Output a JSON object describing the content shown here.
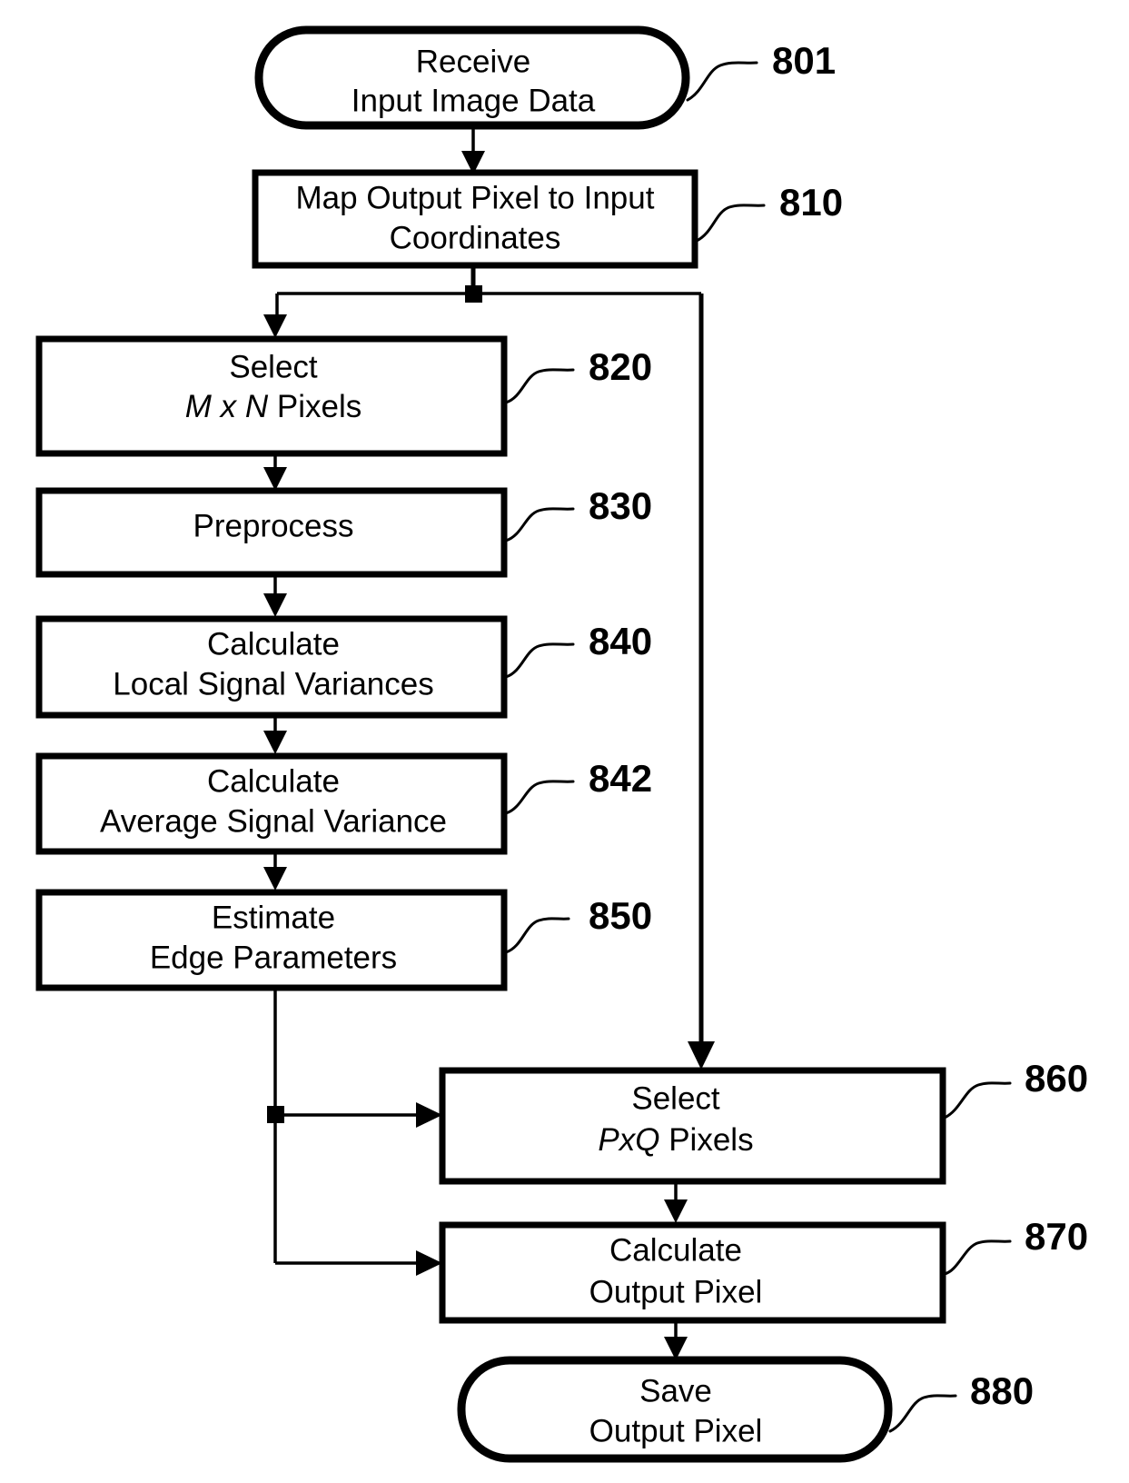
{
  "figure": {
    "type": "flowchart",
    "title": "",
    "background_color": "#ffffff",
    "line_color": "#000000",
    "text_color": "#000000"
  },
  "nodes": [
    {
      "id": "801",
      "shape": "terminator",
      "ref": "801",
      "line1": "Receive",
      "line2": "Input Image  Data"
    },
    {
      "id": "810",
      "shape": "process",
      "ref": "810",
      "line1": "Map Output Pixel to Input",
      "line2": "Coordinates"
    },
    {
      "id": "820",
      "shape": "process",
      "ref": "820",
      "line1": "Select",
      "line2_italic": "M x N",
      "line2_rest": " Pixels"
    },
    {
      "id": "830",
      "shape": "process",
      "ref": "830",
      "line1": "Preprocess",
      "line2": ""
    },
    {
      "id": "840",
      "shape": "process",
      "ref": "840",
      "line1": "Calculate",
      "line2": "Local Signal Variances"
    },
    {
      "id": "842",
      "shape": "process",
      "ref": "842",
      "line1": "Calculate",
      "line2": "Average Signal Variance"
    },
    {
      "id": "850",
      "shape": "process",
      "ref": "850",
      "line1": "Estimate",
      "line2": "Edge Parameters"
    },
    {
      "id": "860",
      "shape": "process",
      "ref": "860",
      "line1": "Select",
      "line2_italic": "PxQ",
      "line2_rest": " Pixels"
    },
    {
      "id": "870",
      "shape": "process",
      "ref": "870",
      "line1": "Calculate",
      "line2": "Output Pixel"
    },
    {
      "id": "880",
      "shape": "terminator",
      "ref": "880",
      "line1": "Save",
      "line2": "Output Pixel"
    }
  ],
  "edges": [
    {
      "from": "801",
      "to": "810",
      "style": "arrow-down"
    },
    {
      "from": "810",
      "to": "820",
      "style": "branch-left-down"
    },
    {
      "from": "810",
      "to": "860",
      "style": "branch-right-down"
    },
    {
      "from": "820",
      "to": "830",
      "style": "arrow-down"
    },
    {
      "from": "830",
      "to": "840",
      "style": "arrow-down"
    },
    {
      "from": "840",
      "to": "842",
      "style": "arrow-down"
    },
    {
      "from": "842",
      "to": "850",
      "style": "arrow-down"
    },
    {
      "from": "850",
      "to": "860",
      "style": "down-then-right"
    },
    {
      "from": "850",
      "to": "870",
      "style": "down-then-right"
    },
    {
      "from": "860",
      "to": "870",
      "style": "arrow-down"
    },
    {
      "from": "870",
      "to": "880",
      "style": "arrow-down"
    }
  ]
}
